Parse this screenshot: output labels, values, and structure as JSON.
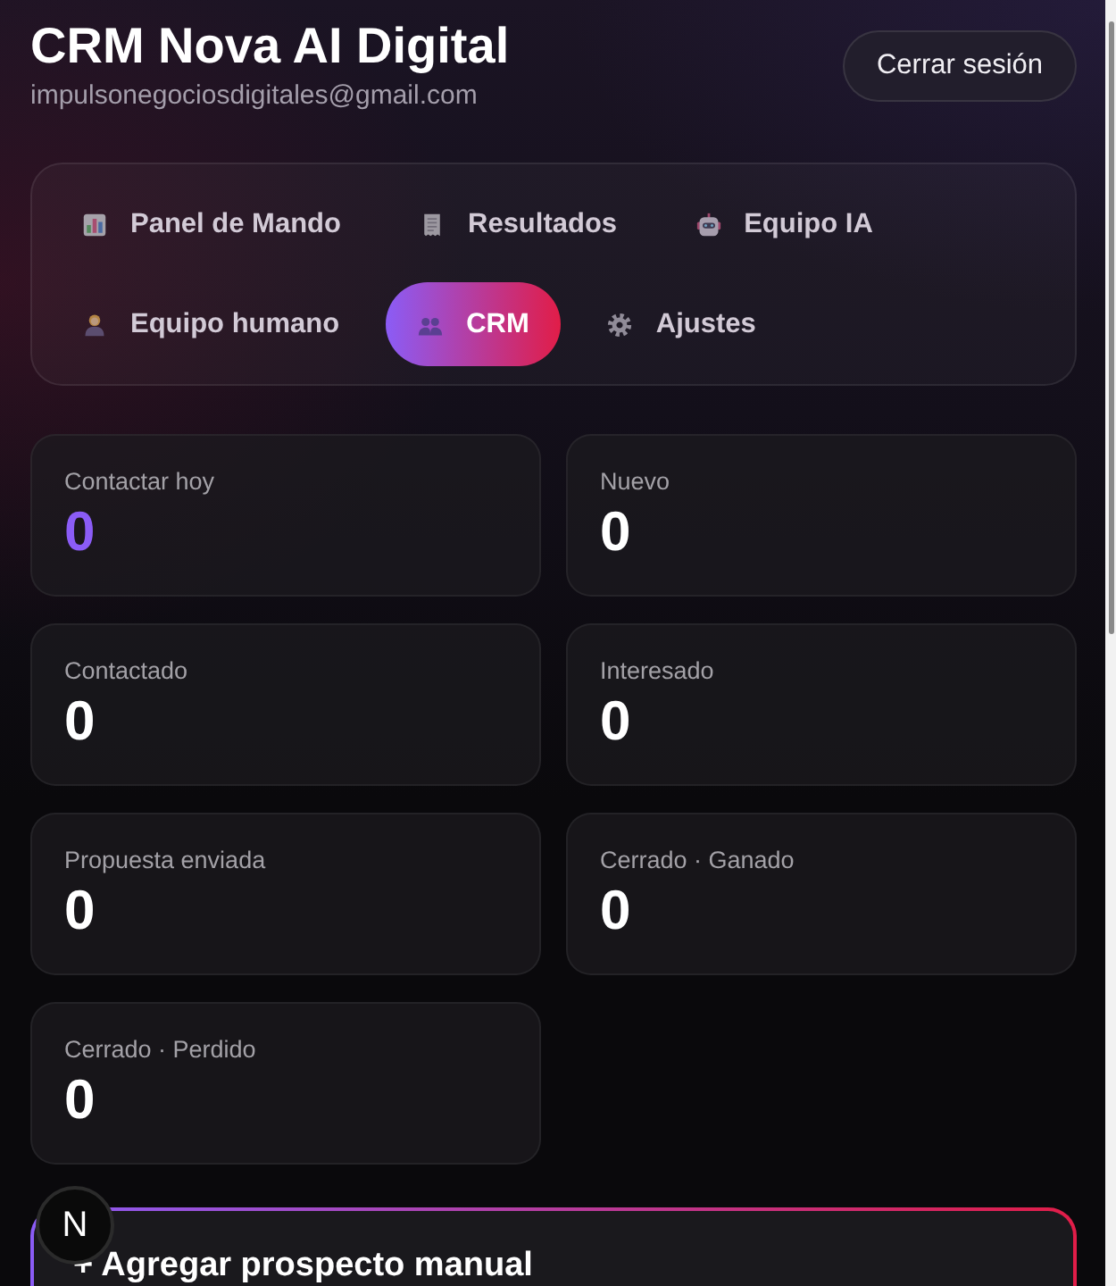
{
  "header": {
    "title": "CRM Nova AI Digital",
    "email": "impulsonegociosdigitales@gmail.com",
    "logout_button": "Cerrar sesión"
  },
  "nav_tabs": [
    {
      "label": "Panel de Mando",
      "selected": false
    },
    {
      "label": "Resultados",
      "selected": false
    },
    {
      "label": "Equipo IA",
      "selected": false
    },
    {
      "label": "Equipo humano",
      "selected": false
    },
    {
      "label": "CRM",
      "selected": true
    },
    {
      "label": "Ajustes",
      "selected": false
    }
  ],
  "stats": [
    {
      "label": "Contactar hoy",
      "value": "0",
      "highlighted": true
    },
    {
      "label": "Nuevo",
      "value": "0",
      "highlighted": false
    },
    {
      "label": "Contactado",
      "value": "0",
      "highlighted": false
    },
    {
      "label": "Interesado",
      "value": "0",
      "highlighted": false
    },
    {
      "label": "Propuesta enviada",
      "value": "0",
      "highlighted": false
    },
    {
      "label": "Cerrado · Ganado",
      "value": "0",
      "highlighted": false
    },
    {
      "label": "Cerrado · Perdido",
      "value": "0",
      "highlighted": false
    }
  ],
  "add_prospect": {
    "title": "+ Agregar prospecto manual"
  },
  "dev_badge": {
    "label": "N"
  }
}
